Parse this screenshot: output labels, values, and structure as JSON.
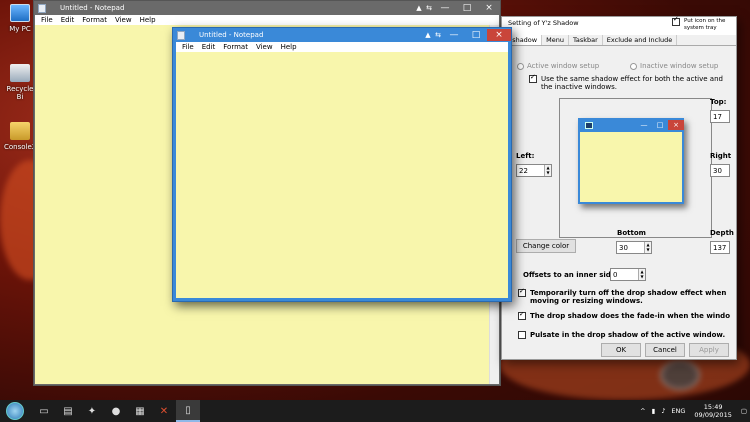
{
  "desktop": {
    "icons": [
      {
        "label": "My PC",
        "icon": "computer-icon"
      },
      {
        "label": "Recycle Bi",
        "icon": "recycle-bin-icon"
      },
      {
        "label": "Console2",
        "icon": "folder-icon"
      }
    ]
  },
  "notepad_back": {
    "title": "Untitled - Notepad",
    "menu": [
      "File",
      "Edit",
      "Format",
      "View",
      "Help"
    ]
  },
  "notepad_front": {
    "title": "Untitled - Notepad",
    "menu": [
      "File",
      "Edit",
      "Format",
      "View",
      "Help"
    ],
    "minimize": "—",
    "maximize": "□",
    "close": "×"
  },
  "yz_shadow": {
    "title": "Setting of Y'z Shadow",
    "tray_checkbox": "Put icon on the system tray",
    "tabs": [
      "p shadow",
      "Menu",
      "Taskbar",
      "Exclude and Include"
    ],
    "active_window_setup": "Active window setup",
    "inactive_window_setup": "Inactive window setup",
    "same_effect": "Use the same shadow effect for both the active and the inactive windows.",
    "top_label": "Top:",
    "top_value": "17",
    "left_label": "Left:",
    "left_value": "22",
    "right_label": "Right",
    "right_value": "30",
    "bottom_label": "Bottom",
    "bottom_value": "30",
    "depth_label": "Depth",
    "depth_value": "137",
    "change_color": "Change color",
    "offsets_label": "Offsets to an inner side:",
    "offsets_value": "0",
    "temp_off": "Temporarily turn off the drop shadow effect when moving or resizing windows.",
    "fade_in": "The drop shadow does the fade-in when the window get a",
    "pulsate": "Pulsate in the drop shadow of the active window.",
    "ok": "OK",
    "cancel": "Cancel",
    "apply": "Apply"
  },
  "taskbar": {
    "lang": "ENG",
    "time": "15:49",
    "date": "09/09/2015"
  }
}
